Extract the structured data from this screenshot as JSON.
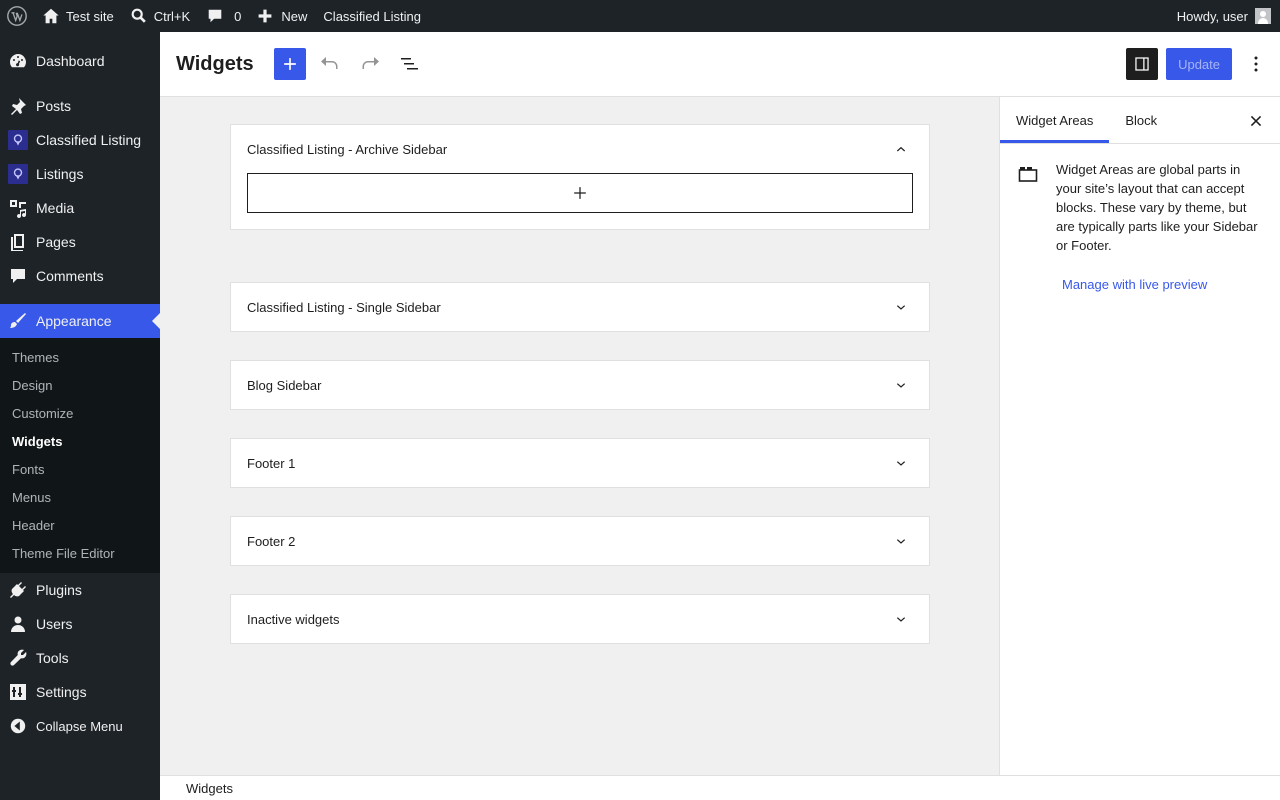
{
  "adminbar": {
    "site_name": "Test site",
    "search_shortcut": "Ctrl+K",
    "comments_count": "0",
    "new_label": "New",
    "plugin_link": "Classified Listing",
    "howdy": "Howdy, user"
  },
  "menu": {
    "dashboard": "Dashboard",
    "posts": "Posts",
    "classified_listing": "Classified Listing",
    "listings": "Listings",
    "media": "Media",
    "pages": "Pages",
    "comments": "Comments",
    "appearance": "Appearance",
    "sub": {
      "themes": "Themes",
      "design": "Design",
      "customize": "Customize",
      "widgets": "Widgets",
      "fonts": "Fonts",
      "menus": "Menus",
      "header": "Header",
      "theme_file_editor": "Theme File Editor"
    },
    "plugins": "Plugins",
    "users": "Users",
    "tools": "Tools",
    "settings": "Settings",
    "collapse": "Collapse Menu"
  },
  "header": {
    "title": "Widgets",
    "update_label": "Update"
  },
  "widget_areas": [
    {
      "title": "Classified Listing - Archive Sidebar",
      "expanded": true
    },
    {
      "title": "Classified Listing - Single Sidebar",
      "expanded": false
    },
    {
      "title": "Blog Sidebar",
      "expanded": false
    },
    {
      "title": "Footer 1",
      "expanded": false
    },
    {
      "title": "Footer 2",
      "expanded": false
    },
    {
      "title": "Inactive widgets",
      "expanded": false
    }
  ],
  "panel": {
    "tab_widget_areas": "Widget Areas",
    "tab_block": "Block",
    "description": "Widget Areas are global parts in your site’s layout that can accept blocks. These vary by theme, but are typically parts like your Sidebar or Footer.",
    "live_preview_link": "Manage with live preview"
  },
  "footer": {
    "breadcrumb": "Widgets"
  },
  "colors": {
    "accent": "#3858e9",
    "adminbar_bg": "#1d2327",
    "submenu_bg": "#101517"
  }
}
